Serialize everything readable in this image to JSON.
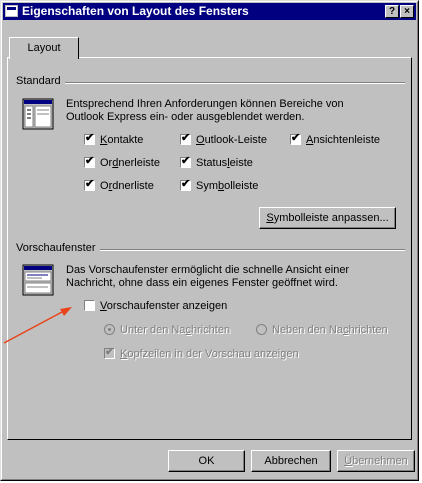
{
  "window": {
    "title": "Eigenschaften von Layout des Fensters",
    "help_glyph": "?",
    "close_glyph": "×"
  },
  "tabs": [
    {
      "label": "Layout"
    }
  ],
  "standard": {
    "label": "Standard",
    "desc_line1": "Entsprechend Ihren Anforderungen können Bereiche von",
    "desc_line2": "Outlook Express ein- oder ausgeblendet werden.",
    "checkboxes": {
      "kontakte": {
        "pre": "",
        "key": "K",
        "post": "ontakte",
        "checked": true
      },
      "outlook_leiste": {
        "pre": "",
        "key": "O",
        "post": "utlook-Leiste",
        "checked": true
      },
      "ansichtenleiste": {
        "pre": "",
        "key": "A",
        "post": "nsichtenleiste",
        "checked": true
      },
      "ordnerleiste": {
        "pre": "Or",
        "key": "d",
        "post": "nerleiste",
        "checked": true
      },
      "statusleiste": {
        "pre": "Status",
        "key": "l",
        "post": "eiste",
        "checked": true
      },
      "ordnerliste": {
        "pre": "O",
        "key": "r",
        "post": "dnerliste",
        "checked": true
      },
      "symbolleiste": {
        "pre": "Sym",
        "key": "b",
        "post": "olleiste",
        "checked": true
      }
    },
    "customize_button": {
      "key": "S",
      "post": "ymbolleiste anpassen..."
    }
  },
  "preview": {
    "label": "Vorschaufenster",
    "desc_line1": "Das Vorschaufenster ermöglicht die schnelle Ansicht einer",
    "desc_line2": "Nachricht, ohne dass ein eigenes Fenster geöffnet wird.",
    "show_preview": {
      "pre": "",
      "key": "V",
      "post": "orschaufenster anzeigen",
      "checked": false
    },
    "radio_below": {
      "pre": "Unter den Na",
      "key": "c",
      "post": "hrichten",
      "selected": true
    },
    "radio_beside": {
      "pre": "Neben den Na",
      "key": "c",
      "post": "hrichten",
      "selected": false
    },
    "show_headers": {
      "pre": "",
      "key": "K",
      "post": "opfzeilen in der Vorschau anzeigen",
      "checked": true
    }
  },
  "buttons": {
    "ok": "OK",
    "cancel": "Abbrechen",
    "apply_key": "Ü",
    "apply_post": "bernehmen"
  },
  "colors": {
    "titlebar": "#000080",
    "face": "#c0c0c0",
    "arrow": "#e8431a"
  },
  "icons": {
    "check": "✔"
  }
}
